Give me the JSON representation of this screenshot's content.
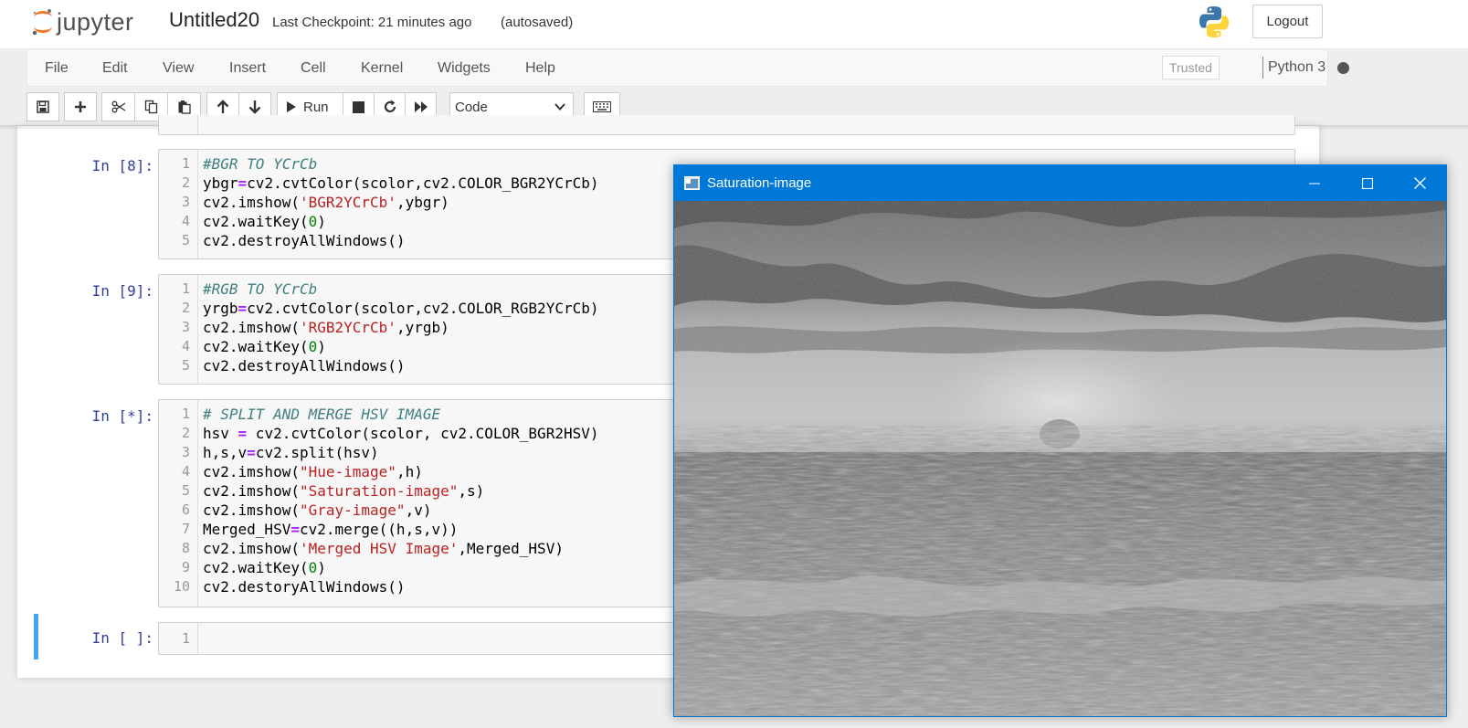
{
  "header": {
    "logo_text": "jupyter",
    "notebook_name": "Untitled20",
    "checkpoint": "Last Checkpoint: 21 minutes ago",
    "autosave_status": "(autosaved)",
    "logout_label": "Logout"
  },
  "menubar": {
    "items": [
      "File",
      "Edit",
      "View",
      "Insert",
      "Cell",
      "Kernel",
      "Widgets",
      "Help"
    ],
    "trusted_label": "Trusted",
    "kernel_name": "Python 3"
  },
  "toolbar": {
    "run_label": "Run",
    "cell_type": "Code"
  },
  "cells": [
    {
      "prompt": "In [8]:",
      "lines": [
        "#BGR TO YCrCb",
        "ybgr=cv2.cvtColor(scolor,cv2.COLOR_BGR2YCrCb)",
        "cv2.imshow('BGR2YCrCb',ybgr)",
        "cv2.waitKey(0)",
        "cv2.destroyAllWindows()"
      ]
    },
    {
      "prompt": "In [9]:",
      "lines": [
        "#RGB TO YCrCb",
        "yrgb=cv2.cvtColor(scolor,cv2.COLOR_RGB2YCrCb)",
        "cv2.imshow('RGB2YCrCb',yrgb)",
        "cv2.waitKey(0)",
        "cv2.destroyAllWindows()"
      ]
    },
    {
      "prompt": "In [*]:",
      "lines": [
        "# SPLIT AND MERGE HSV IMAGE",
        "hsv = cv2.cvtColor(scolor, cv2.COLOR_BGR2HSV)",
        "h,s,v=cv2.split(hsv)",
        "cv2.imshow(\"Hue-image\",h)",
        "cv2.imshow(\"Saturation-image\",s)",
        "cv2.imshow(\"Gray-image\",v)",
        "Merged_HSV=cv2.merge((h,s,v))",
        "cv2.imshow('Merged HSV Image',Merged_HSV)",
        "cv2.waitKey(0)",
        "cv2.destoryAllWindows()"
      ]
    },
    {
      "prompt": "In [ ]:",
      "lines": [
        ""
      ]
    }
  ],
  "cv_window": {
    "title": "Saturation-image"
  },
  "colors": {
    "prompt": "#303f9f",
    "comment": "#408080",
    "string": "#ba2121",
    "number": "#008000",
    "operator": "#aa22ff",
    "selected_cell_bar": "#42a5f5",
    "window_titlebar": "#0078d7"
  }
}
